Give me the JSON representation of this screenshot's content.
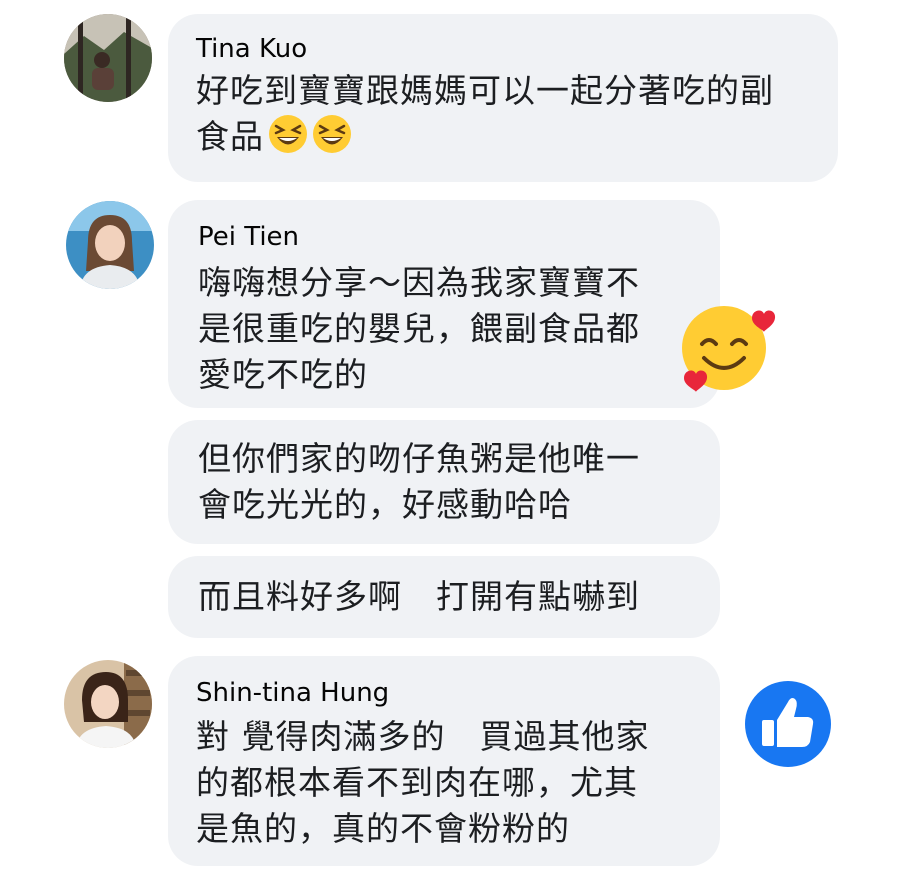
{
  "comments": [
    {
      "name": "Tina Kuo",
      "lines": [
        "好吃到寶寶跟媽媽可以一起分著吃的副",
        "食品"
      ],
      "inline_emojis": [
        "grinning-squinting-face-emoji",
        "grinning-squinting-face-emoji"
      ]
    },
    {
      "name": "Pei Tien",
      "lines": [
        "嗨嗨想分享～因為我家寶寶不",
        "是很重吃的嬰兒，餵副食品都",
        "愛吃不吃的"
      ],
      "reaction": "smiling-face-with-hearts-emoji"
    },
    {
      "lines": [
        "但你們家的吻仔魚粥是他唯一",
        "會吃光光的，好感動哈哈"
      ]
    },
    {
      "lines": [
        "而且料好多啊　打開有點嚇到"
      ]
    },
    {
      "name": "Shin-tina Hung",
      "lines": [
        "對 覺得肉滿多的　買過其他家",
        "的都根本看不到肉在哪，尤其",
        "是魚的，真的不會粉粉的"
      ],
      "reaction": "like-icon"
    }
  ],
  "colors": {
    "bubble": "#f0f2f5",
    "like": "#1877f2",
    "emoji_yellow": "#ffcc33",
    "heart": "#e8263a"
  }
}
